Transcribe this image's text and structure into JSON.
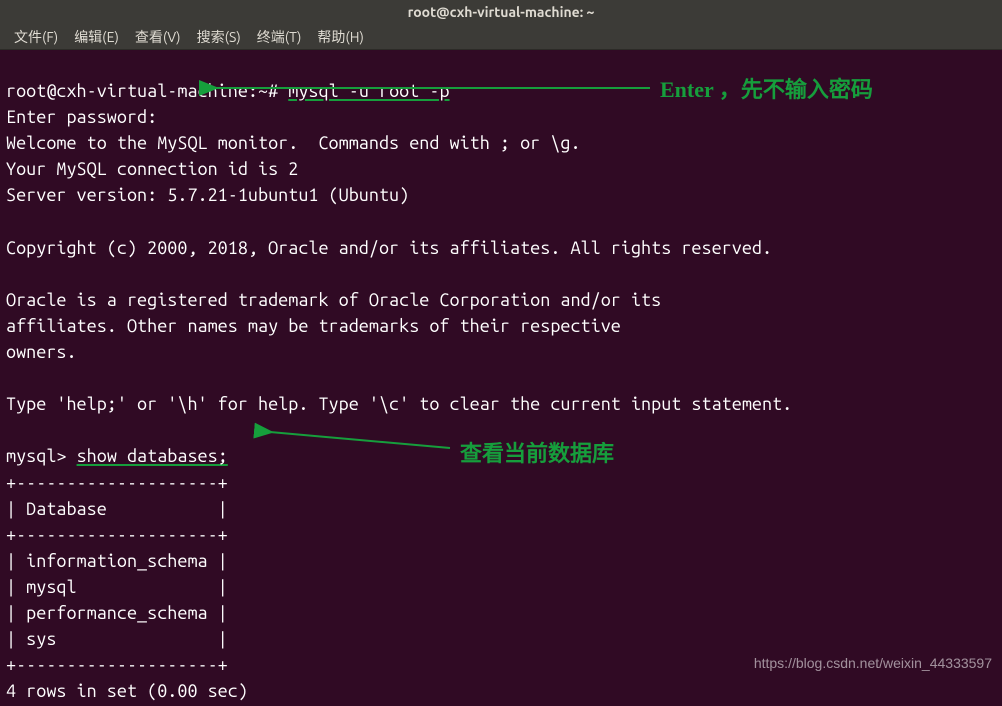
{
  "window": {
    "title": "root@cxh-virtual-machine: ~"
  },
  "menubar": {
    "items": [
      "文件(F)",
      "编辑(E)",
      "查看(V)",
      "搜索(S)",
      "终端(T)",
      "帮助(H)"
    ]
  },
  "terminal": {
    "prompt": "root@cxh-virtual-machine:~#",
    "cmd1": "mysql -u root -p",
    "line_enter_pw": "Enter password: ",
    "line_welcome": "Welcome to the MySQL monitor.  Commands end with ; or \\g.",
    "line_connid": "Your MySQL connection id is 2",
    "line_server": "Server version: 5.7.21-1ubuntu1 (Ubuntu)",
    "line_copyright": "Copyright (c) 2000, 2018, Oracle and/or its affiliates. All rights reserved.",
    "line_trademark1": "Oracle is a registered trademark of Oracle Corporation and/or its",
    "line_trademark2": "affiliates. Other names may be trademarks of their respective",
    "line_trademark3": "owners.",
    "line_help": "Type 'help;' or '\\h' for help. Type '\\c' to clear the current input statement.",
    "mysql_prompt": "mysql>",
    "cmd2": "show databases;",
    "tbl_border": "+--------------------+",
    "tbl_header": "| Database           |",
    "tbl_row1": "| information_schema |",
    "tbl_row2": "| mysql              |",
    "tbl_row3": "| performance_schema |",
    "tbl_row4": "| sys                |",
    "line_rows": "4 rows in set (0.00 sec)"
  },
  "annotations": {
    "a1": "Enter ，先不输入密码",
    "a2": "查看当前数据库"
  },
  "watermark": "https://blog.csdn.net/weixin_44333597"
}
